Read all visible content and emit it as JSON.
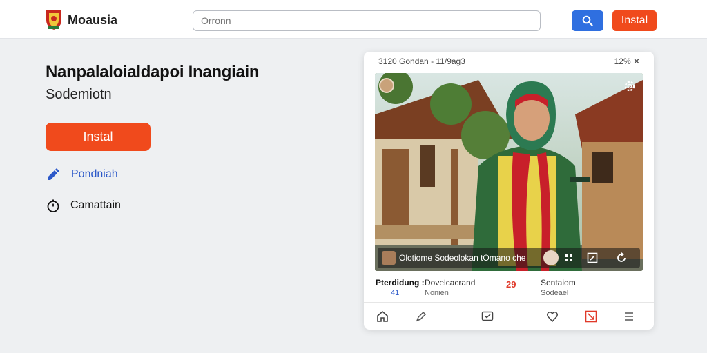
{
  "header": {
    "brand": "Moausia",
    "search_placeholder": "Orronn",
    "install_label": "Instal"
  },
  "main": {
    "title": "Nanpalaloialdapoi Inangiain",
    "subtitle": "Sodemiotn",
    "install_label": "Instal",
    "link_label": "Pondniah",
    "info_label": "Camattain"
  },
  "phone": {
    "status_left": "3120 Gondan - 11/9ag3",
    "status_right": "12% ✕",
    "caption": "Olotiome Sodeolokan tOmano che",
    "meta": {
      "label": "Pterdidung :",
      "number": "41",
      "col_a_title": "Dovelcacrand",
      "col_a_sub": "Nonien",
      "count": "29",
      "col_b_title": "Sentaiom",
      "col_b_sub": "Sodeael"
    }
  },
  "colors": {
    "accent_orange": "#f04a1c",
    "accent_blue": "#2f6fe0"
  },
  "icons": {
    "logo": "crest-logo-icon",
    "search": "search-icon",
    "link": "pencil-tag-icon",
    "info": "stopwatch-icon",
    "gear": "gear-icon",
    "nav": [
      "home-icon",
      "edit-icon",
      "chat-icon",
      "heart-icon",
      "share-icon",
      "menu-icon"
    ]
  }
}
